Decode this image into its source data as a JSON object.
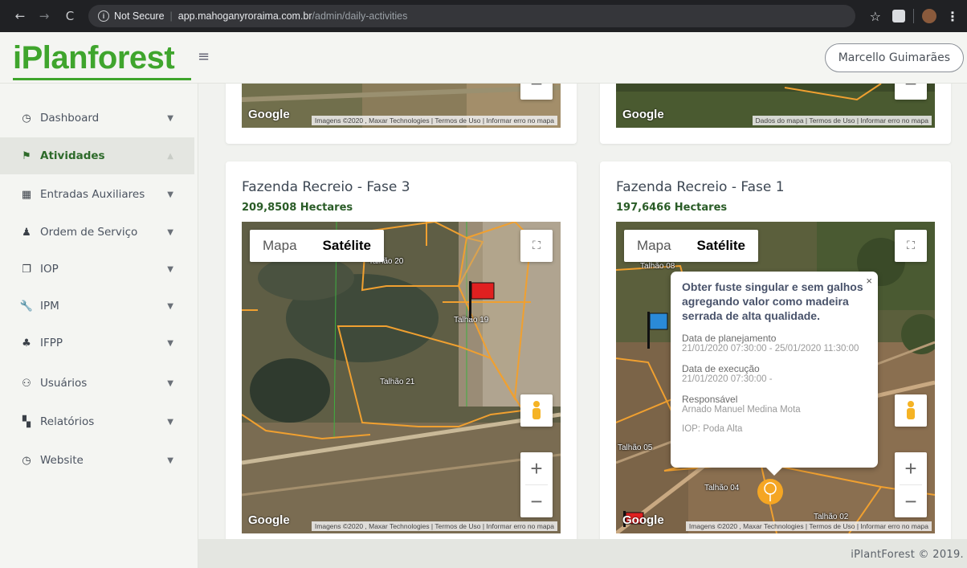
{
  "browser": {
    "secure_label": "Not Secure",
    "url_host": "app.mahoganyroraima.com.br",
    "url_path": "/admin/daily-activities"
  },
  "header": {
    "logo": "iPlanforest",
    "user_name": "Marcello Guimarães"
  },
  "sidebar": {
    "items": [
      {
        "label": "Dashboard",
        "icon": "dashboard-icon"
      },
      {
        "label": "Atividades",
        "icon": "flag-icon"
      },
      {
        "label": "Entradas Auxiliares",
        "icon": "table-icon"
      },
      {
        "label": "Ordem de Serviço",
        "icon": "worker-icon"
      },
      {
        "label": "IOP",
        "icon": "copy-icon"
      },
      {
        "label": "IPM",
        "icon": "wrench-icon"
      },
      {
        "label": "IFPP",
        "icon": "tree-icon"
      },
      {
        "label": "Usuários",
        "icon": "users-icon"
      },
      {
        "label": "Relatórios",
        "icon": "map-book-icon"
      },
      {
        "label": "Website",
        "icon": "dashboard-icon"
      }
    ]
  },
  "map_common": {
    "google": "Google",
    "type_map": "Mapa",
    "type_satellite": "Satélite",
    "zoom_in": "+",
    "zoom_out": "−"
  },
  "top_cards": {
    "left_attrib": "Imagens ©2020 , Maxar Technologies | Termos de Uso | Informar erro no mapa",
    "right_attrib": "Dados do mapa | Termos de Uso | Informar erro no mapa"
  },
  "cards": [
    {
      "title": "Fazenda Recreio - Fase 3",
      "area": "209,8508 Hectares",
      "attrib": "Imagens ©2020 , Maxar Technologies | Termos de Uso | Informar erro no mapa",
      "plot_labels": [
        "Talhão 20",
        "Talhão 19",
        "Talhão 21"
      ]
    },
    {
      "title": "Fazenda Recreio - Fase 1",
      "area": "197,6466 Hectares",
      "attrib": "Imagens ©2020 , Maxar Technologies | Termos de Uso | Informar erro no mapa",
      "plot_labels": [
        "Talhão 08",
        "Talhão 05",
        "Talhão 04",
        "Talhão 02"
      ],
      "popup": {
        "close": "×",
        "title": "Obter fuste singular e sem galhos agregando valor como madeira serrada de alta qualidade.",
        "planning_label": "Data de planejamento",
        "planning_value": "21/01/2020 07:30:00 - 25/01/2020 11:30:00",
        "execution_label": "Data de execução",
        "execution_value": "21/01/2020 07:30:00 -",
        "responsible_label": "Responsável",
        "responsible_value": "Arnado Manuel Medina Mota",
        "iop": "IOP: Poda Alta"
      }
    }
  ],
  "footer": {
    "text": "iPlantForest © 2019."
  },
  "colors": {
    "brand": "#3fa52d",
    "plot_border": "#f0a030",
    "flag_red": "#e02020",
    "flag_blue": "#2a8ad8"
  }
}
